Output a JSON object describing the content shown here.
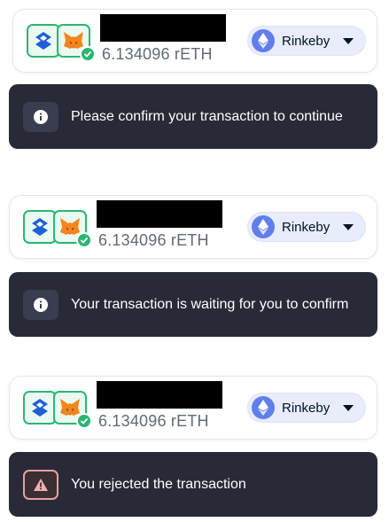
{
  "wallet": {
    "balance": "6.134096 rETH",
    "network": "Rinkeby",
    "logos": [
      "safe-logo-icon",
      "metamask-fox-icon",
      "check-icon"
    ],
    "network_icon": "ethereum-icon",
    "connected_color": "#2bb673",
    "network_color": "#627eea"
  },
  "notifications": [
    {
      "icon": "info-icon",
      "message": "Please confirm your transaction to continue"
    },
    {
      "icon": "info-icon",
      "message": "Your transaction is waiting for you to confirm"
    },
    {
      "icon": "warning-icon",
      "message": "You rejected the transaction"
    }
  ],
  "colors": {
    "toast_bg": "#282a37",
    "error_accent": "#e8a0a0"
  }
}
